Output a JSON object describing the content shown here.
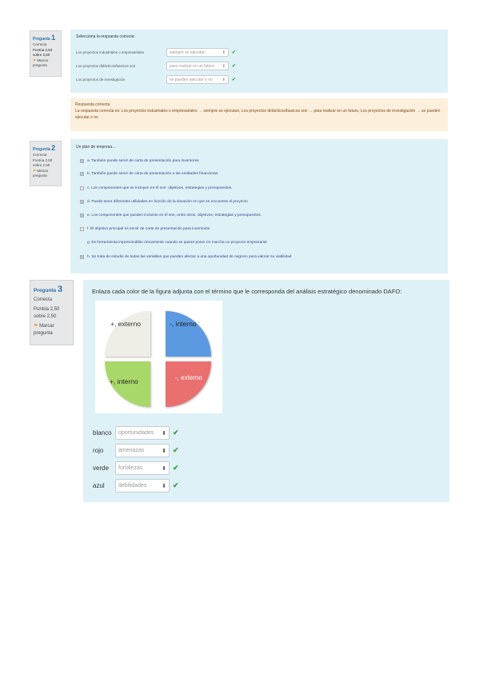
{
  "q1": {
    "info": {
      "label": "Pregunta",
      "number": "1",
      "status": "Correcta",
      "score": "Puntúa 2,50 sobre 2,50",
      "flag": "Marcar pregunta"
    },
    "prompt": "Selecciona la respuesta correcta:",
    "rows": [
      {
        "label": "Los proyectos industriales o empresariales",
        "value": "siempre se ejecutan"
      },
      {
        "label": "Los proyectos didácticos/basicos son",
        "value": "para realizar en un futuro"
      },
      {
        "label": "Los proyectos de investigación",
        "value": "se pueden ejecutar o no"
      }
    ],
    "feedback": {
      "title": "Respuesta correcta",
      "text": "La respuesta correcta es: Los proyectos industriales o empresariales → siempre se ejecutan, Los proyectos didácticos/basicos son → para realizar en un futuro, Los proyectos de investigación → se pueden ejecutar o no"
    }
  },
  "q2": {
    "info": {
      "label": "Pregunta",
      "number": "2",
      "status": "Correcta",
      "score": "Puntúa 2,50 sobre 2,50",
      "flag": "Marcar pregunta"
    },
    "prompt": "Un plan de empresa...",
    "options": [
      {
        "text": "a. También puede servir de carta de presentación para inversores",
        "checked": true
      },
      {
        "text": "b. También puede servir de carta de presentación a las entidades financieras",
        "checked": true
      },
      {
        "text": "c. Los componentes que se incluyen en él son: objetivos, estrategias y presupuestos.",
        "checked": false
      },
      {
        "text": "d. Puede tener diferentes utilidades en función de la situación en que se encuentre el proyecto",
        "checked": true
      },
      {
        "text": "e. Los componentes que pueden incluirse en él son, entre otros, objetivos, estrategias y presupuestos.",
        "checked": true
      },
      {
        "text": "f. El objetivo principal es servir de carta de presentación para inversores",
        "checked": false
      },
      {
        "text": "g. Es herramienta imprescindible únicamente cuando se quiere poner en marcha un proyecto empresarial",
        "checked": false
      },
      {
        "text": "h. Se trata de estudio de todas las variables que pueden afectar a una oportunidad de negocio para valorar su viabilidad",
        "checked": true
      }
    ]
  },
  "q3": {
    "info": {
      "label": "Pregunta",
      "number": "3",
      "status": "Correcta",
      "score": "Puntúa 2,50 sobre 2,50",
      "flag": "Marcar pregunta"
    },
    "prompt": "Enlaza cada color de la figura adjunta con el término que le corresponda del análisis estratégico denominado DAFO:",
    "figure": {
      "tl": {
        "text": "+, externo",
        "color": "#efeee6"
      },
      "tr": {
        "text": "-, interno",
        "color": "#5b9ae0"
      },
      "bl": {
        "text": "+, interno",
        "color": "#a9d86a"
      },
      "br": {
        "text": "-, externo",
        "color": "#ea6f6f"
      }
    },
    "rows": [
      {
        "label": "blanco",
        "value": "oportunidades"
      },
      {
        "label": "rojo",
        "value": "amenazas"
      },
      {
        "label": "verde",
        "value": "fortalezas"
      },
      {
        "label": "azul",
        "value": "debilidades"
      }
    ]
  },
  "icons": {
    "check": "✔",
    "select_arrow": "⬍",
    "flag": "⚑"
  }
}
